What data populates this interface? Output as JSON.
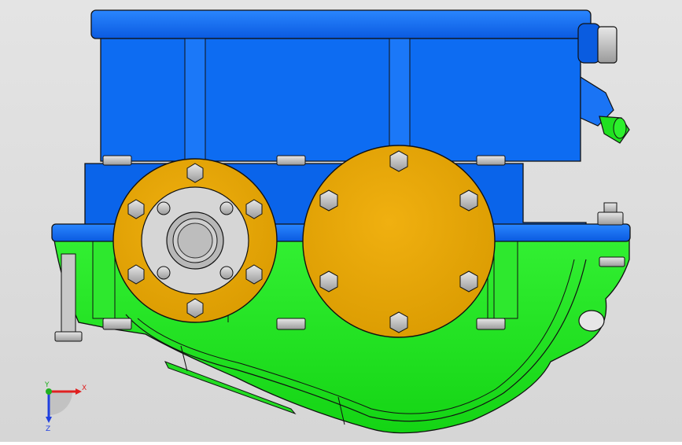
{
  "viewport": {
    "background": "#dcdcdc",
    "model": {
      "upper_housing_color": "#0a6cf5",
      "lower_housing_color": "#1ee81e",
      "flange_color": "#e0a000",
      "shaft_color": "#c8c8c8",
      "bolt_color": "#bdbdbd"
    },
    "triad": {
      "x_label": "X",
      "y_label": "Y",
      "z_label": "Z",
      "x_color": "#e02020",
      "y_color": "#20b020",
      "z_color": "#2040e0"
    }
  }
}
